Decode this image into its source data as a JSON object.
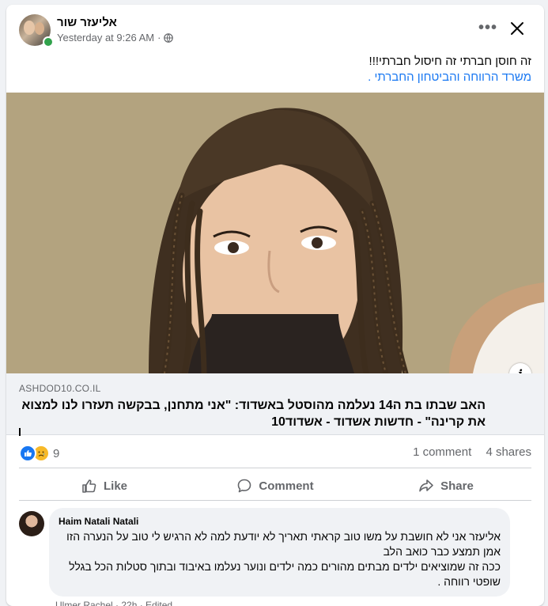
{
  "post": {
    "author": "אליעזר שור",
    "timestamp": "Yesterday at 9:26 AM",
    "separator": "·",
    "more_label": "•••",
    "text_line1": "זה חוסן חברתי זה חיסול חברתי!!!",
    "text_line2": "משרד הרווחה והביטחון החברתי ."
  },
  "link_preview": {
    "domain": "ASHDOD10.CO.IL",
    "title": "האב שבתו בת ה14 נעלמה מהוסטל באשדוד: \"אני מתחנן, בבקשה תעזרו לנו למצוא את קרינה\" - חדשות אשדוד - אשדוד10",
    "info_label": "i"
  },
  "stats": {
    "reaction_count": "9",
    "comments": "1 comment",
    "shares": "4 shares"
  },
  "actions": {
    "like": "Like",
    "comment": "Comment",
    "share": "Share"
  },
  "comment": {
    "author": "Haim Natali Natali",
    "line1": "אליעזר אני לא חושבת על משו טוב קראתי תאריך לא יודעת למה לא הרגיש לי טוב על הנערה הזו",
    "line2": "אמן תמצע כבר כואב הלב",
    "line3": "ככה זה שמוציאים ילדים מבתים מהורים כמה ילדים ונוער נעלמו באיבוד ובתוך סטלות הכל בגלל",
    "line4": "שופטי רווחה ."
  },
  "next_comment_partial": "Ulmer Rachel · 22h · Edited",
  "colors": {
    "link_blue": "#1877f2",
    "muted": "#65676b",
    "online": "#31a24c"
  }
}
